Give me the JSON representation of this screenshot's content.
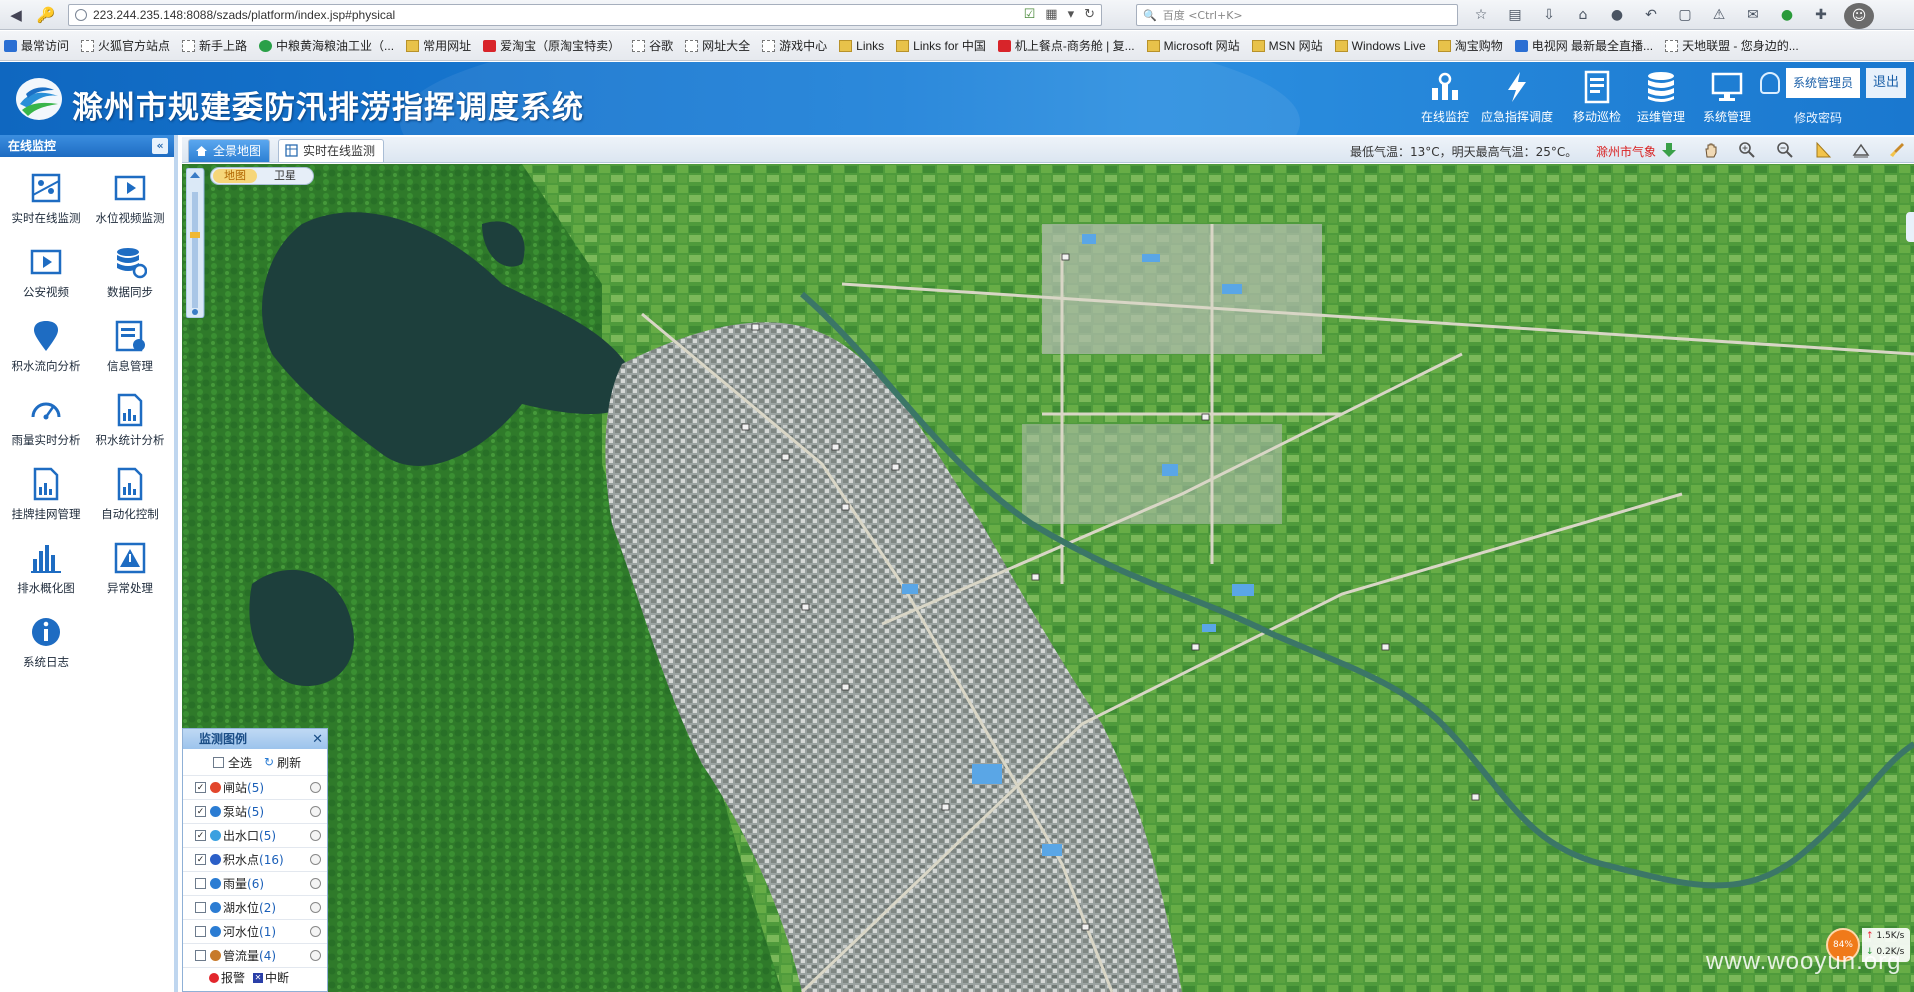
{
  "browser": {
    "url": "223.244.235.148:8088/szads/platform/index.jsp#physical",
    "search_placeholder": "百度 <Ctrl+K>"
  },
  "bookmarks": [
    {
      "label": "最常访问",
      "type": "blue"
    },
    {
      "label": "火狐官方站点",
      "type": "page"
    },
    {
      "label": "新手上路",
      "type": "page"
    },
    {
      "label": "中粮黄海粮油工业（...",
      "type": "green"
    },
    {
      "label": "常用网址",
      "type": "folder"
    },
    {
      "label": "爱淘宝（原淘宝特卖）",
      "type": "red"
    },
    {
      "label": "谷歌",
      "type": "page"
    },
    {
      "label": "网址大全",
      "type": "page"
    },
    {
      "label": "游戏中心",
      "type": "page"
    },
    {
      "label": "Links",
      "type": "folder"
    },
    {
      "label": "Links for 中国",
      "type": "folder"
    },
    {
      "label": "机上餐点-商务舱 | 复...",
      "type": "red"
    },
    {
      "label": "Microsoft 网站",
      "type": "folder"
    },
    {
      "label": "MSN 网站",
      "type": "folder"
    },
    {
      "label": "Windows Live",
      "type": "folder"
    },
    {
      "label": "淘宝购物",
      "type": "folder"
    },
    {
      "label": "电视网 最新最全直播...",
      "type": "blue"
    },
    {
      "label": "天地联盟 - 您身边的...",
      "type": "page"
    }
  ],
  "header": {
    "title": "滁州市规建委防汛排涝指挥调度系统",
    "menu": [
      {
        "label": "在线监控",
        "icon": "monitor-network-icon"
      },
      {
        "label": "应急指挥调度",
        "icon": "lightning-icon"
      },
      {
        "label": "移动巡检",
        "icon": "document-list-icon"
      },
      {
        "label": "运维管理",
        "icon": "database-icon"
      },
      {
        "label": "系统管理",
        "icon": "computer-icon"
      }
    ],
    "user": "系统管理员",
    "logout": "退出",
    "change_password": "修改密码"
  },
  "left_panel": {
    "title": "在线监控",
    "items": [
      {
        "label": "实时在线监测",
        "icon": "map-pins-icon"
      },
      {
        "label": "水位视频监测",
        "icon": "video-play-icon"
      },
      {
        "label": "公安视频",
        "icon": "video-play-icon"
      },
      {
        "label": "数据同步",
        "icon": "database-gear-icon"
      },
      {
        "label": "积水流向分析",
        "icon": "location-pin-icon"
      },
      {
        "label": "信息管理",
        "icon": "info-list-icon"
      },
      {
        "label": "雨量实时分析",
        "icon": "gauge-icon"
      },
      {
        "label": "积水统计分析",
        "icon": "report-chart-icon"
      },
      {
        "label": "挂牌挂网管理",
        "icon": "report-chart-icon"
      },
      {
        "label": "自动化控制",
        "icon": "report-chart-icon"
      },
      {
        "label": "排水概化图",
        "icon": "bar-chart-icon"
      },
      {
        "label": "异常处理",
        "icon": "warning-icon"
      },
      {
        "label": "系统日志",
        "icon": "info-circle-icon"
      }
    ]
  },
  "tabs": [
    {
      "label": "全景地图",
      "active": true
    },
    {
      "label": "实时在线监测",
      "active": false
    }
  ],
  "weather": {
    "text": "最低气温：13°C，明天最高气温：25°C。",
    "link": "滁州市气象"
  },
  "map_type": {
    "map": "地图",
    "satellite": "卫星"
  },
  "legend": {
    "title": "监测图例",
    "select_all": "全选",
    "refresh": "刷新",
    "rows": [
      {
        "label": "闸站",
        "count": "(5)",
        "checked": true,
        "color": "#e2462c"
      },
      {
        "label": "泵站",
        "count": "(5)",
        "checked": true,
        "color": "#2b7cd3"
      },
      {
        "label": "出水口",
        "count": "(5)",
        "checked": true,
        "color": "#3aa0e0"
      },
      {
        "label": "积水点",
        "count": "(16)",
        "checked": true,
        "color": "#2b5fc7"
      },
      {
        "label": "雨量",
        "count": "(6)",
        "checked": false,
        "color": "#2b7cd3"
      },
      {
        "label": "湖水位",
        "count": "(2)",
        "checked": false,
        "color": "#2b7cd3"
      },
      {
        "label": "河水位",
        "count": "(1)",
        "checked": false,
        "color": "#2b7cd3"
      },
      {
        "label": "管流量",
        "count": "(4)",
        "checked": false,
        "color": "#c77a2b"
      }
    ],
    "alarm": "报警",
    "interrupt": "中断"
  },
  "network": {
    "percent": "84%",
    "up": "1.5K/s",
    "down": "0.2K/s"
  },
  "watermark": "www.wooyun.org"
}
